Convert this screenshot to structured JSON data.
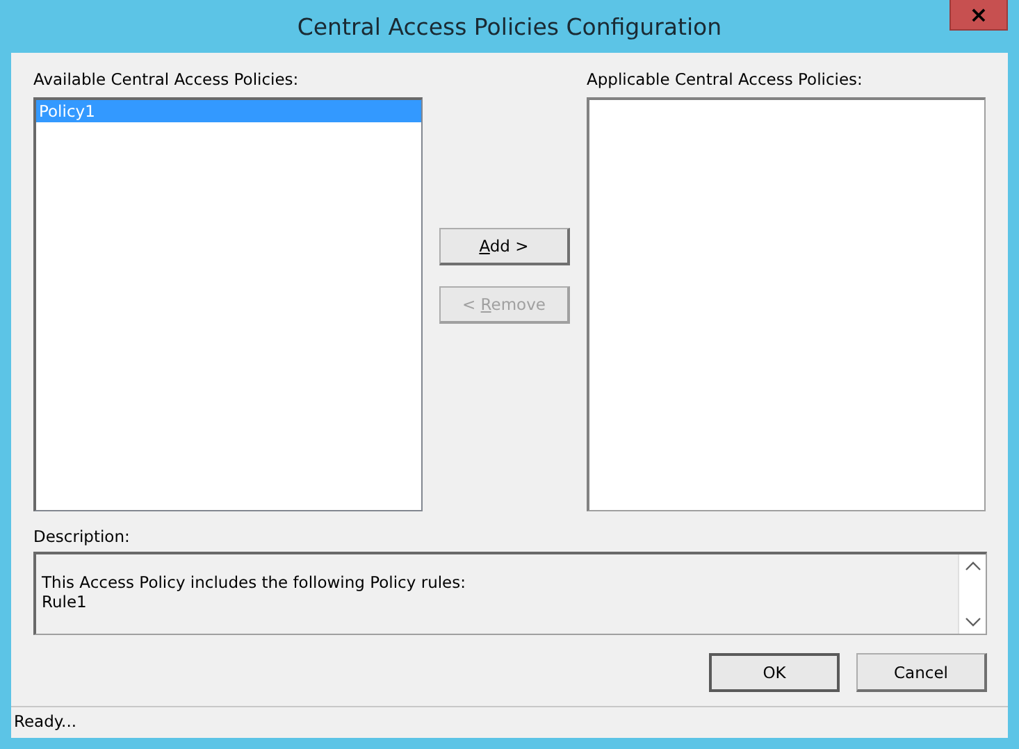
{
  "window": {
    "title": "Central Access Policies Configuration",
    "close": "×"
  },
  "available": {
    "label": "Available Central Access Policies:",
    "items": [
      {
        "label": "Policy1",
        "selected": true
      }
    ]
  },
  "buttons": [
    {
      "access_key": "A",
      "label_after": "dd >",
      "disabled": false
    },
    {
      "label_before": "< ",
      "access_key": "R",
      "label_after": "emove",
      "disabled": true
    }
  ],
  "applicable": {
    "label": "Applicable Central Access Policies:"
  },
  "description": {
    "label": "Description:",
    "lines": [
      "This Access Policy includes the following Policy rules:",
      "Rule1"
    ]
  },
  "dialog_buttons": [
    "OK",
    "Cancel"
  ],
  "status_bar": "Ready..."
}
